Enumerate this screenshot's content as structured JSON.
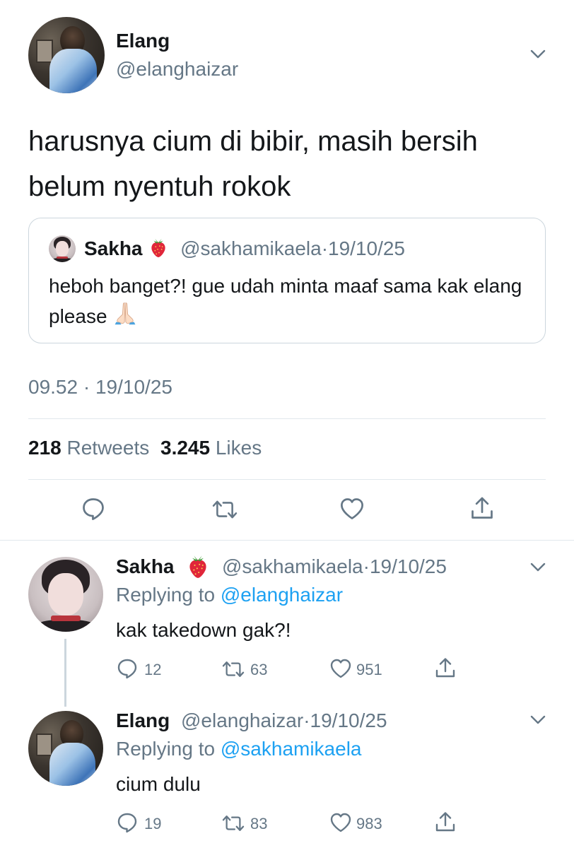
{
  "main_tweet": {
    "author_name": "Elang",
    "author_handle": "@elanghaizar",
    "text": "harusnya cium di bibir, masih bersih belum nyentuh rokok",
    "time": "09.52",
    "date": "19/10/25",
    "retweets": "218",
    "retweets_label": "Retweets",
    "likes": "3.245",
    "likes_label": "Likes"
  },
  "quoted_tweet": {
    "author_name": "Sakha",
    "author_handle": "@sakhamikaela",
    "date": "19/10/25",
    "text": "heboh banget?! gue udah minta maaf sama kak elang please"
  },
  "replies": [
    {
      "author_name": "Sakha",
      "author_handle": "@sakhamikaela",
      "date": "19/10/25",
      "replying_label": "Replying to",
      "replying_to": "@elanghaizar",
      "text": "kak takedown gak?!",
      "reply_count": "12",
      "retweet_count": "63",
      "like_count": "951"
    },
    {
      "author_name": "Elang",
      "author_handle": "@elanghaizar",
      "date": "19/10/25",
      "replying_label": "Replying to",
      "replying_to": "@sakhamikaela",
      "text": "cium dulu",
      "reply_count": "19",
      "retweet_count": "83",
      "like_count": "983"
    }
  ],
  "separator": "·",
  "icons": {
    "strawberry": "strawberry-emoji",
    "folded_hands": "folded-hands-emoji",
    "reply": "reply-icon",
    "retweet": "retweet-icon",
    "like": "heart-icon",
    "share": "share-icon",
    "more": "chevron-down-icon"
  },
  "colors": {
    "text": "#14171a",
    "secondary": "#657786",
    "link": "#1da1f2",
    "border": "#ccd6dd"
  }
}
